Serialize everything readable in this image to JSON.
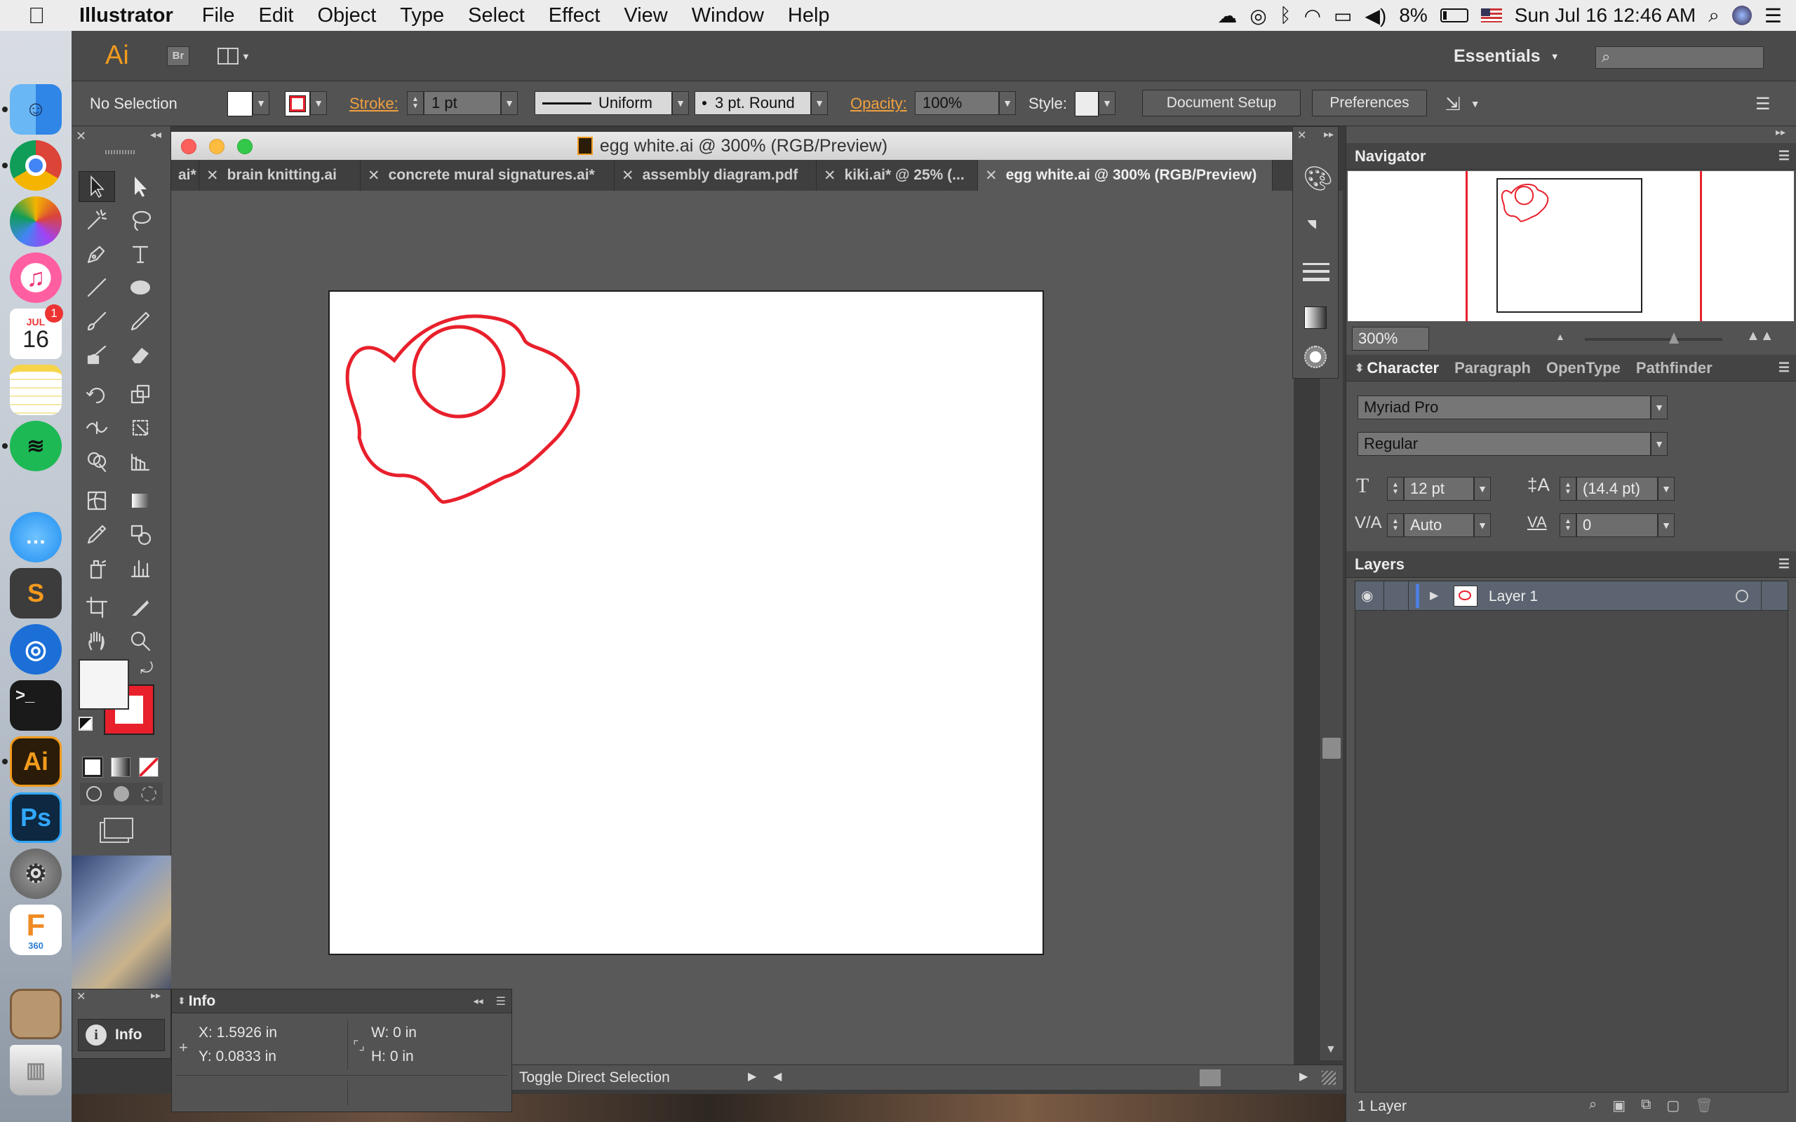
{
  "menubar": {
    "app_name": "Illustrator",
    "items": [
      "File",
      "Edit",
      "Object",
      "Type",
      "Select",
      "Effect",
      "View",
      "Window",
      "Help"
    ],
    "battery": "8%",
    "datetime": "Sun Jul 16  12:46 AM"
  },
  "dock": {
    "calendar_month": "JUL",
    "calendar_day": "16",
    "calendar_badge": "1",
    "ai_label": "Ai",
    "ps_label": "Ps",
    "f360_label": "F",
    "f360_sub": "360",
    "sublime_label": "S",
    "terminal_label": ">_"
  },
  "appbar": {
    "logo": "Ai",
    "bridge": "Br",
    "workspace": "Essentials"
  },
  "control": {
    "selection": "No Selection",
    "stroke_label": "Stroke:",
    "stroke_value": "1 pt",
    "profile": "Uniform",
    "brush": "3 pt. Round",
    "opacity_label": "Opacity:",
    "opacity_value": "100%",
    "style_label": "Style:",
    "doc_setup": "Document Setup",
    "preferences": "Preferences"
  },
  "document": {
    "title": "egg white.ai @ 300% (RGB/Preview)",
    "tabs": [
      "ai*",
      "brain knitting.ai",
      "concrete mural signatures.ai*",
      "assembly diagram.pdf",
      "kiki.ai* @ 25% (...",
      "egg white.ai @ 300% (RGB/Preview)"
    ],
    "stroke_color": "#e8202c"
  },
  "status": {
    "tool": "Toggle Direct Selection"
  },
  "navigator": {
    "title": "Navigator",
    "zoom": "300%"
  },
  "character": {
    "tabs": [
      "Character",
      "Paragraph",
      "OpenType",
      "Pathfinder"
    ],
    "font": "Myriad Pro",
    "style": "Regular",
    "size": "12 pt",
    "leading": "(14.4 pt)",
    "kerning": "Auto",
    "tracking": "0"
  },
  "layers": {
    "title": "Layers",
    "layer_name": "Layer 1",
    "count": "1 Layer"
  },
  "info": {
    "title": "Info",
    "collapsed_label": "Info",
    "x": "X:  1.5926 in",
    "y": "Y:  0.0833 in",
    "w": "W:  0 in",
    "h": "H:  0 in"
  }
}
